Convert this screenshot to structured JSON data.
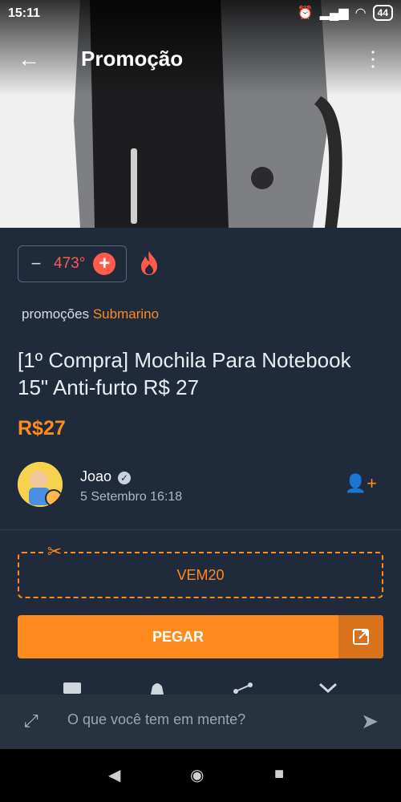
{
  "statusbar": {
    "time": "15:11",
    "battery": "44"
  },
  "appbar": {
    "title": "Promoção"
  },
  "votes": {
    "minus": "−",
    "value": "473°",
    "plus": "+"
  },
  "store": {
    "prefix": "promoções",
    "name": "Submarino"
  },
  "deal": {
    "title": "[1º Compra] Mochila Para Notebook 15\" Anti-furto R$ 27",
    "price": "R$27"
  },
  "author": {
    "name": "Joao",
    "date": "5 Setembro 16:18"
  },
  "coupon": {
    "code": "VEM20"
  },
  "cta": {
    "label": "PEGAR"
  },
  "composer": {
    "placeholder": "O que você tem em mente?"
  },
  "colors": {
    "accent": "#ff8a1e",
    "hot": "#ff5a4a",
    "background": "#1f2b3a"
  }
}
